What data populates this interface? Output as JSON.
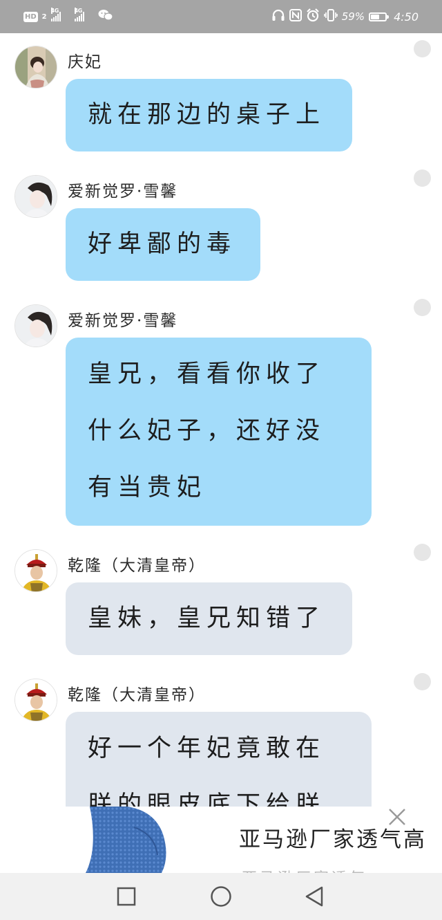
{
  "status_bar": {
    "hd_label": "HD",
    "sim_number": "2",
    "network_1": "4G",
    "network_2": "4G",
    "battery_percent": "59%",
    "battery_level": 0.59,
    "time": "4:50",
    "icons": [
      "hd-icon",
      "signal-icon",
      "wechat-icon",
      "headphones-icon",
      "nfc-icon",
      "alarm-icon",
      "vibrate-icon",
      "battery-icon"
    ]
  },
  "messages": [
    {
      "sender": "庆妃",
      "text": "就在那边的桌子上",
      "style": "blue"
    },
    {
      "sender": "爱新觉罗·雪馨",
      "text": "好卑鄙的毒",
      "style": "blue"
    },
    {
      "sender": "爱新觉罗·雪馨",
      "text": "皇兄，看看你收了\n什么妃子，还好没\n有当贵妃",
      "style": "blue"
    },
    {
      "sender": "乾隆（大清皇帝）",
      "text": "皇妹，皇兄知错了",
      "style": "gray"
    },
    {
      "sender": "乾隆（大清皇帝）",
      "text": "好一个年妃竟敢在\n朕的眼皮底下给朕",
      "style": "gray"
    }
  ],
  "ad": {
    "title": "亚马逊厂家透气高",
    "subtitle": "亚马逊厂家透气",
    "close_icon": "close-icon"
  },
  "colors": {
    "status_bar": "#a5a5a5",
    "bubble_blue": "#a3dcfa",
    "bubble_gray": "#e0e6ee",
    "nav_bar": "#f1f1f1"
  },
  "nav": {
    "icons": [
      "recent-apps-icon",
      "home-icon",
      "back-icon"
    ]
  }
}
